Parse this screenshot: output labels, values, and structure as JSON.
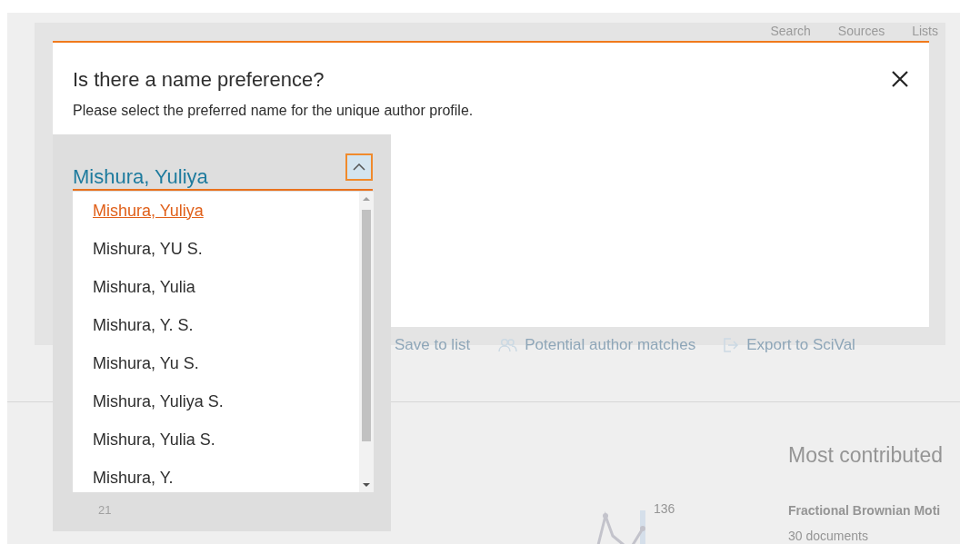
{
  "nav": [
    "Search",
    "Sources",
    "Lists"
  ],
  "toolbar": [
    "Save to list",
    "Potential author matches",
    "Export to SciVal"
  ],
  "background": {
    "panel_title": "Most contributed",
    "document_title": "Fractional Brownian Moti",
    "document_count": "30 documents",
    "chart_label": "136",
    "axis_label": "21"
  },
  "dialog": {
    "title": "Is there a name preference?",
    "subtitle": "Please select the preferred name for the unique author profile.",
    "dropdown": {
      "value": "Mishura, Yuliya",
      "expanded": true,
      "options": [
        {
          "label": "Mishura, Yuliya",
          "selected": true
        },
        {
          "label": "Mishura, YU S.",
          "selected": false
        },
        {
          "label": "Mishura, Yulia",
          "selected": false
        },
        {
          "label": "Mishura, Y. S.",
          "selected": false
        },
        {
          "label": "Mishura, Yu S.",
          "selected": false
        },
        {
          "label": "Mishura, Yuliya S.",
          "selected": false
        },
        {
          "label": "Mishura, Yulia S.",
          "selected": false
        },
        {
          "label": "Mishura, Y.",
          "selected": false
        }
      ]
    }
  }
}
